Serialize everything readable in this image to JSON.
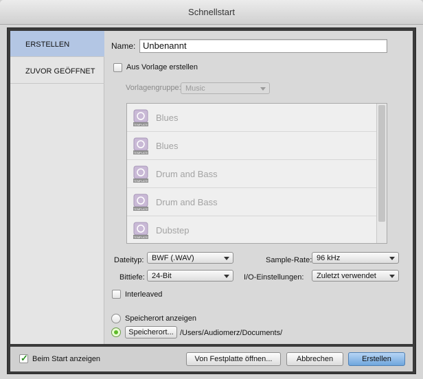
{
  "window": {
    "title": "Schnellstart"
  },
  "sidebar": {
    "items": [
      {
        "label": "ERSTELLEN",
        "active": true
      },
      {
        "label": "ZUVOR GEÖFFNET",
        "active": false
      }
    ]
  },
  "form": {
    "name_label": "Name:",
    "name_value": "Unbenannt",
    "template_checkbox_label": "Aus Vorlage erstellen",
    "template_checked": false,
    "template_group_label": "Vorlagengruppe:",
    "template_group_value": "Music",
    "templates": [
      {
        "label": "Blues",
        "icon": "template-file-icon",
        "icon_text": "TEMPLATE"
      },
      {
        "label": "Blues",
        "icon": "template-file-icon",
        "icon_text": "TEMPLATE"
      },
      {
        "label": "Drum and Bass",
        "icon": "template-file-icon",
        "icon_text": "TEMPLATE"
      },
      {
        "label": "Drum and Bass",
        "icon": "template-file-icon",
        "icon_text": "TEMPLATE"
      },
      {
        "label": "Dubstep",
        "icon": "template-file-icon",
        "icon_text": "TEMPLATE"
      }
    ],
    "filetype_label": "Dateityp:",
    "filetype_value": "BWF (.WAV)",
    "samplerate_label": "Sample-Rate:",
    "samplerate_value": "96 kHz",
    "bitdepth_label": "Bittiefe:",
    "bitdepth_value": "24-Bit",
    "io_label": "I/O-Einstellungen:",
    "io_value": "Zuletzt verwendet",
    "interleaved_label": "Interleaved",
    "interleaved_checked": false,
    "show_location_label": "Speicherort anzeigen",
    "location_button_label": "Speicherort...",
    "location_path": "/Users/Audiomerz/Documents/"
  },
  "footer": {
    "show_on_start_label": "Beim Start anzeigen",
    "show_on_start_checked": true,
    "open_from_disk_label": "Von Festplatte öffnen...",
    "cancel_label": "Abbrechen",
    "create_label": "Erstellen"
  },
  "colors": {
    "accent_active_tab": "#b3c6e4",
    "radio_selected": "#5dbb29",
    "checkmark": "#2b8f22"
  }
}
